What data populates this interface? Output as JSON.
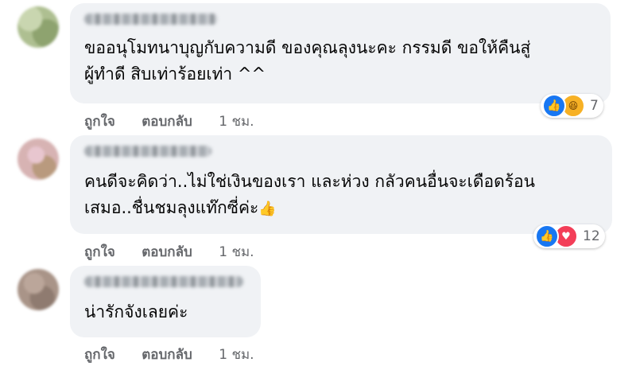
{
  "comments": [
    {
      "text_lines": [
        "ขออนุโมทนาบุญกับความดี ของคุณลุงนะคะ กรรมดี ขอให้คืนสู่",
        "ผู้ทำดี สิบเท่าร้อยเท่า ^^"
      ],
      "reactions": {
        "icons": [
          "like-icon",
          "haha-icon"
        ],
        "count": "7"
      },
      "actions": {
        "like": "ถูกใจ",
        "reply": "ตอบกลับ",
        "time": "1 ชม."
      }
    },
    {
      "text_lines": [
        "คนดีจะคิดว่า..ไม่ใช่เงินของเรา และห่วง กลัวคนอื่นจะเดือดร้อน",
        "เสมอ..ชื่นชมลุงแท๊กซี่ค่ะ"
      ],
      "emoji": "👍",
      "reactions": {
        "icons": [
          "like-icon",
          "love-icon"
        ],
        "count": "12"
      },
      "actions": {
        "like": "ถูกใจ",
        "reply": "ตอบกลับ",
        "time": "1 ชม."
      }
    },
    {
      "text_lines": [
        "น่ารักจังเลยค่ะ"
      ],
      "actions": {
        "like": "ถูกใจ",
        "reply": "ตอบกลับ",
        "time": "1 ชม."
      }
    }
  ],
  "colors": {
    "bubble": "#f0f2f5",
    "meta": "#65676b",
    "like": "#1877f2",
    "love": "#f33e58",
    "haha": "#f7b125"
  }
}
